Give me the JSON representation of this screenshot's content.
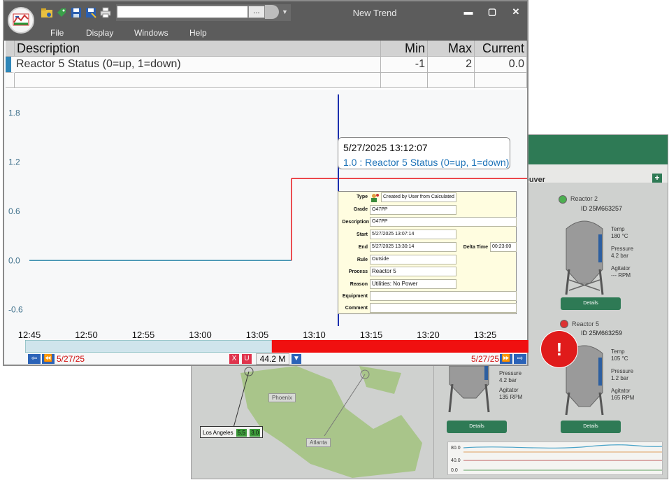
{
  "app": {
    "window_title": "New Trend",
    "path_value": "",
    "browse_label": "...",
    "menu": [
      "File",
      "Display",
      "Windows",
      "Help"
    ],
    "window_controls": {
      "minimize": "▬",
      "maximize": "▢",
      "close": "✕"
    }
  },
  "grid": {
    "headers": [
      "Description",
      "Min",
      "Max",
      "Current"
    ],
    "rows": [
      {
        "description": "Reactor 5 Status (0=up, 1=down)",
        "min": "-1",
        "max": "2",
        "current": "0.0"
      }
    ]
  },
  "chart_data": {
    "type": "line",
    "x_ticks": [
      "12:45",
      "12:50",
      "12:55",
      "13:00",
      "13:05",
      "13:10",
      "13:15",
      "13:20",
      "13:25"
    ],
    "y_ticks": [
      "1.8",
      "1.2",
      "0.6",
      "0.0",
      "-0.6"
    ],
    "ylim": [
      -0.8,
      2.0
    ],
    "series": [
      {
        "name": "Reactor 5 Status (0=up, 1=down)",
        "points": [
          {
            "x": "12:45",
            "y": 0.0
          },
          {
            "x": "13:08",
            "y": 0.0
          },
          {
            "x": "13:08",
            "y": 1.0
          },
          {
            "x": "13:30",
            "y": 1.0
          }
        ],
        "colors": {
          "normal": "#3d8fb0",
          "alarm": "#e8161b"
        }
      }
    ],
    "cursor_time": "13:12:07"
  },
  "tooltip": {
    "date": "5/27/2025 13:12:07",
    "value_line": "1.0 :  Reactor 5 Status (0=up, 1=down)"
  },
  "event": {
    "type_label": "Type",
    "type_value": "Created by User from Calculated",
    "grade_label": "Grade",
    "grade_value": "O47PP",
    "description_label": "Description",
    "description_value": "O47PP",
    "start_label": "Start",
    "start_value": "5/27/2025 13:07:14",
    "end_label": "End",
    "end_value": "5/27/2025 13:30:14",
    "delta_label": "Delta Time",
    "delta_value": "00:23:00",
    "rule_label": "Rule",
    "rule_value": "Outside",
    "process_label": "Process",
    "process_value": "Reactor 5",
    "reason_label": "Reason",
    "reason_value": "Utilities: No Power",
    "equipment_label": "Equipment",
    "equipment_value": "",
    "comment_label": "Comment",
    "comment_value": ""
  },
  "nav": {
    "start_date": "5/27/25",
    "end_date": "5/27/25",
    "x_label": "X",
    "u_label": "U",
    "memory": "44.2 M",
    "alarm_fraction": 0.51
  },
  "dashboard": {
    "site_title": "couver",
    "plus_label": "+",
    "reactor2": {
      "name": "Reactor 2",
      "id": "ID  25M663257",
      "temp_label": "Temp",
      "temp": "180 °C",
      "pressure_label": "Pressure",
      "pressure": "4.2 bar",
      "agitator_label": "Agitator",
      "agitator": "--- RPM",
      "details": "Details"
    },
    "reactor5": {
      "name": "Reactor 5",
      "id": "ID  25M663259",
      "temp_label": "Temp",
      "temp": "105 °C",
      "pressure_label": "Pressure",
      "pressure": "1.2 bar",
      "agitator_label": "Agitator",
      "agitator": "165 RPM",
      "details": "Details"
    },
    "reactor_left": {
      "pressure_label": "Pressure",
      "pressure": "4.2 bar",
      "agitator_label": "Agitator",
      "agitator": "135 RPM",
      "details": "Details"
    },
    "map": {
      "phoenix": "Phoenix",
      "atlanta": "Atlanta",
      "la": "Los Angeles",
      "la_v1": "5.5",
      "la_v2": "3.0"
    },
    "mini_chart_ticks": [
      "80.0",
      "40.0",
      "0.0"
    ],
    "alert_symbol": "!"
  }
}
